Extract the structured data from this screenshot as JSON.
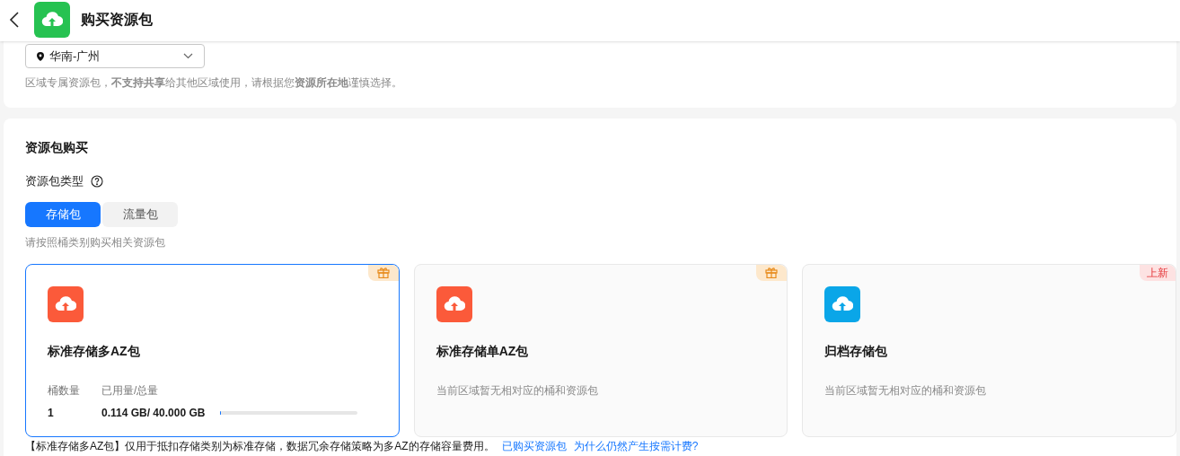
{
  "header": {
    "title": "购买资源包"
  },
  "region": {
    "value": "华南-广州",
    "note": "区域专属资源包，**不支持共享**给其他区域使用，请根据您**资源所在地**谨慎选择。"
  },
  "purchase": {
    "title": "资源包购买",
    "type_label": "资源包类型",
    "tabs": [
      {
        "label": "存储包",
        "selected": true
      },
      {
        "label": "流量包",
        "selected": false
      }
    ],
    "hint": "请按照桶类别购买相关资源包"
  },
  "packages": [
    {
      "name": "标准存储多AZ包",
      "selected": true,
      "color": "#fb5a3a",
      "badge": {
        "kind": "gift"
      },
      "kind": "usage",
      "columns": [
        "桶数量",
        "已用量/总量"
      ],
      "count": "1",
      "usage": "0.114 GB/ 40.000 GB",
      "level": 0.003
    },
    {
      "name": "标准存储单AZ包",
      "selected": false,
      "color": "#fb5a3a",
      "badge": {
        "kind": "gift"
      },
      "kind": "empty",
      "message": "当前区域暂无相对应的桶和资源包"
    },
    {
      "name": "归档存储包",
      "selected": false,
      "color": "#0aa6e8",
      "badge": {
        "kind": "new",
        "label": "上新"
      },
      "kind": "empty",
      "message": "当前区域暂无相对应的桶和资源包"
    }
  ],
  "footer": {
    "note": "【标准存储多AZ包】仅用于抵扣存储类别为标准存储，数据冗余存储策略为多AZ的存储容量费用。",
    "links": [
      "已购买资源包",
      "为什么仍然产生按需计费?"
    ]
  }
}
